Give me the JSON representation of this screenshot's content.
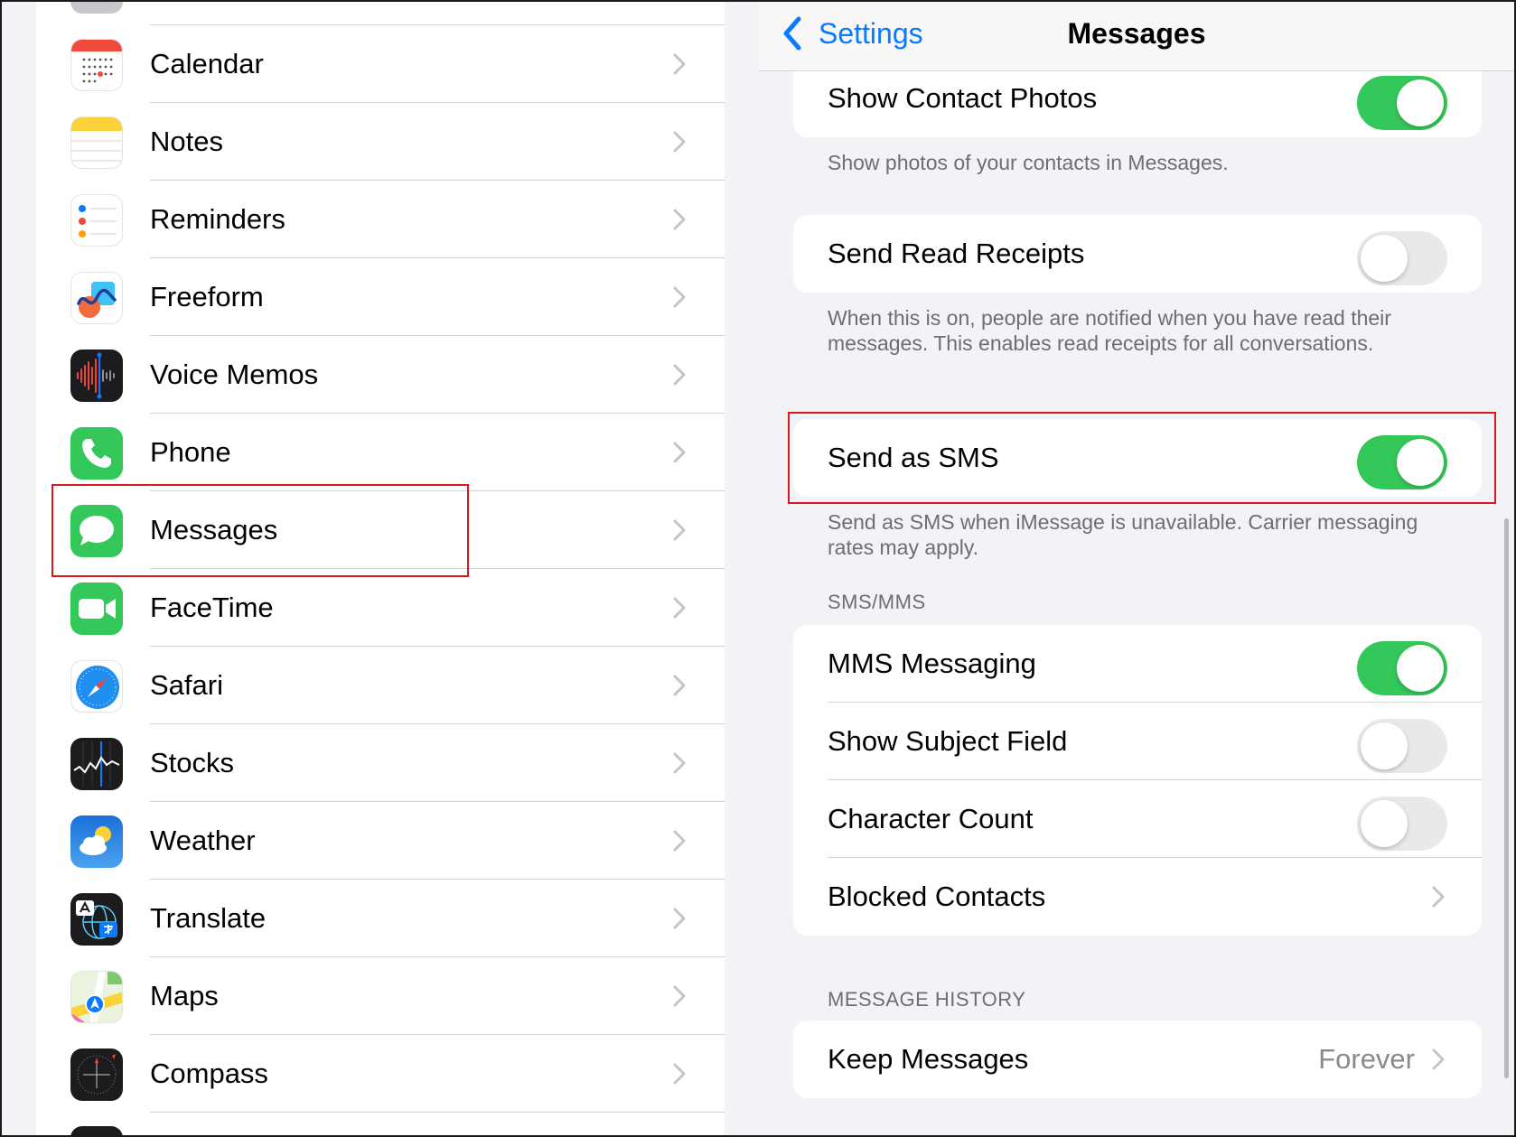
{
  "left_list": {
    "items": [
      {
        "label": "Calendar",
        "icon": "calendar-icon"
      },
      {
        "label": "Notes",
        "icon": "notes-icon"
      },
      {
        "label": "Reminders",
        "icon": "reminders-icon"
      },
      {
        "label": "Freeform",
        "icon": "freeform-icon"
      },
      {
        "label": "Voice Memos",
        "icon": "voice-memos-icon"
      },
      {
        "label": "Phone",
        "icon": "phone-icon"
      },
      {
        "label": "Messages",
        "icon": "messages-icon"
      },
      {
        "label": "FaceTime",
        "icon": "facetime-icon"
      },
      {
        "label": "Safari",
        "icon": "safari-icon"
      },
      {
        "label": "Stocks",
        "icon": "stocks-icon"
      },
      {
        "label": "Weather",
        "icon": "weather-icon"
      },
      {
        "label": "Translate",
        "icon": "translate-icon"
      },
      {
        "label": "Maps",
        "icon": "maps-icon"
      },
      {
        "label": "Compass",
        "icon": "compass-icon"
      }
    ]
  },
  "nav": {
    "back_label": "Settings",
    "title": "Messages"
  },
  "settings": {
    "show_contact_photos": {
      "label": "Show Contact Photos",
      "on": true
    },
    "show_contact_photos_footer": "Show photos of your contacts in Messages.",
    "send_read_receipts": {
      "label": "Send Read Receipts",
      "on": false
    },
    "send_read_receipts_footer": "When this is on, people are notified when you have read their messages. This enables read receipts for all conversations.",
    "send_as_sms": {
      "label": "Send as SMS",
      "on": true
    },
    "send_as_sms_footer": "Send as SMS when iMessage is unavailable. Carrier messaging rates may apply.",
    "sms_mms_header": "SMS/MMS",
    "mms_messaging": {
      "label": "MMS Messaging",
      "on": true
    },
    "show_subject_field": {
      "label": "Show Subject Field",
      "on": false
    },
    "character_count": {
      "label": "Character Count",
      "on": false
    },
    "blocked_contacts": {
      "label": "Blocked Contacts"
    },
    "message_history_header": "MESSAGE HISTORY",
    "keep_messages": {
      "label": "Keep Messages",
      "value": "Forever"
    }
  },
  "colors": {
    "accent": "#0a7aff",
    "toggle_on": "#34c759",
    "toggle_off": "#e9e9eb",
    "highlight": "#d71920"
  }
}
